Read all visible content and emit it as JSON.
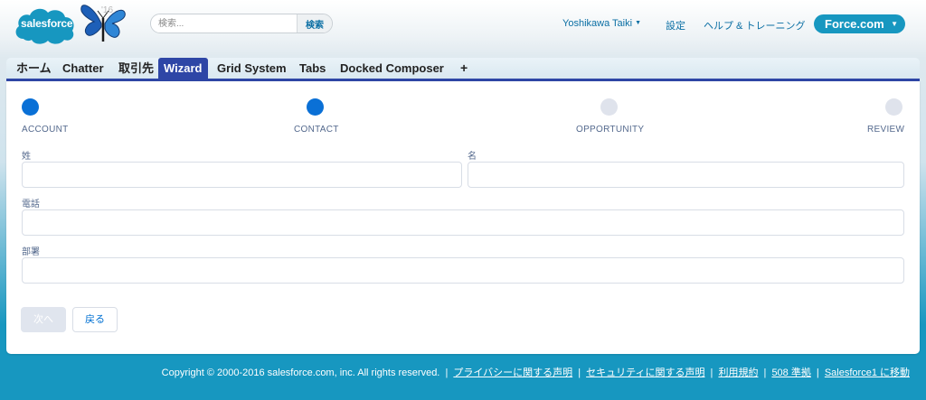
{
  "header": {
    "logo_text": "salesforce",
    "year_mark": "'16",
    "search": {
      "placeholder": "検索...",
      "button_label": "検索"
    },
    "user_name": "Yoshikawa Taiki",
    "settings_label": "設定",
    "help_label": "ヘルプ & トレーニング",
    "app_menu_label": "Force.com"
  },
  "tabs": [
    {
      "label": "ホーム"
    },
    {
      "label": "Chatter"
    },
    {
      "label": "取引先"
    },
    {
      "label": "Wizard",
      "active": true
    },
    {
      "label": "Grid System"
    },
    {
      "label": "Tabs"
    },
    {
      "label": "Docked Composer"
    },
    {
      "label": "+"
    }
  ],
  "wizard": {
    "steps": [
      {
        "label": "ACCOUNT",
        "state": "done"
      },
      {
        "label": "CONTACT",
        "state": "done"
      },
      {
        "label": "OPPORTUNITY",
        "state": "todo"
      },
      {
        "label": "REVIEW",
        "state": "todo"
      }
    ],
    "fields": {
      "last_name": {
        "label": "姓",
        "value": ""
      },
      "first_name": {
        "label": "名",
        "value": ""
      },
      "phone": {
        "label": "電話",
        "value": ""
      },
      "department": {
        "label": "部署",
        "value": ""
      }
    },
    "next_label": "次へ",
    "back_label": "戻る"
  },
  "footer": {
    "copyright": "Copyright © 2000-2016 salesforce.com, inc. All rights reserved.",
    "links": [
      "プライバシーに関する声明",
      "セキュリティに関する声明",
      "利用規約",
      "508 準拠",
      "Salesforce1 に移動"
    ]
  },
  "colors": {
    "brand_blue": "#1797c0",
    "tab_active": "#2e46a6",
    "step_done": "#0a70d6",
    "step_todo": "#dfe3ec"
  }
}
